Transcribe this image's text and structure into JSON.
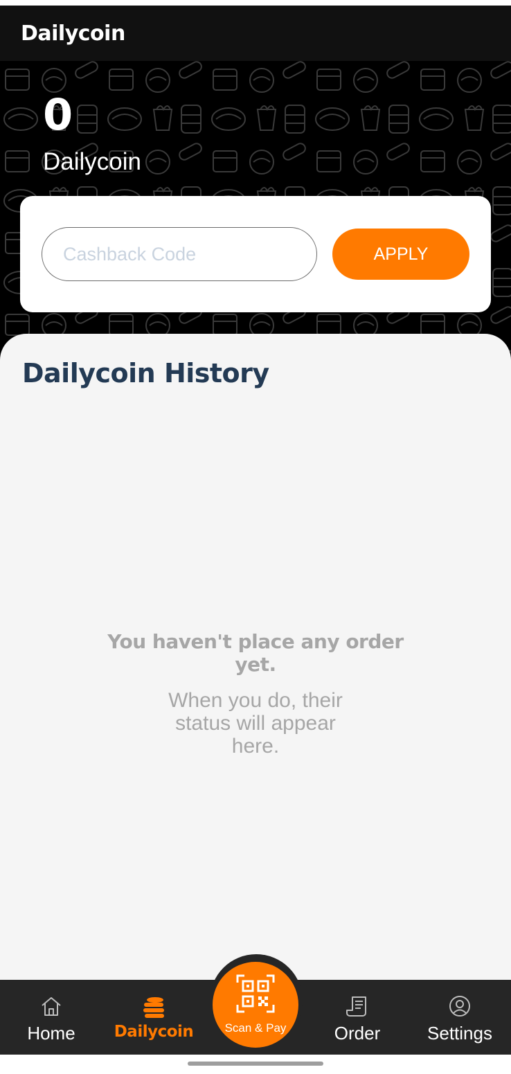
{
  "header": {
    "title": "Dailycoin"
  },
  "balance": {
    "value": "0",
    "label": "Dailycoin"
  },
  "cashback": {
    "placeholder": "Cashback Code",
    "value": "",
    "apply_label": "APPLY"
  },
  "history": {
    "title": "Dailycoin History",
    "empty_title": "You haven't place any order yet.",
    "empty_subtitle": "When you do, their status will appear here."
  },
  "nav": {
    "home": "Home",
    "dailycoin": "Dailycoin",
    "scan": "Scan & Pay",
    "order": "Order",
    "settings": "Settings",
    "active": "dailycoin"
  },
  "colors": {
    "accent": "#ff7a00",
    "header_bg": "#111111",
    "title_text": "#233a54",
    "muted_text": "#a6a6a6",
    "nav_bg": "#262626"
  },
  "icons": [
    "food-pattern",
    "home-icon",
    "coin-stack-icon",
    "qr-code-icon",
    "receipt-icon",
    "user-circle-icon"
  ]
}
